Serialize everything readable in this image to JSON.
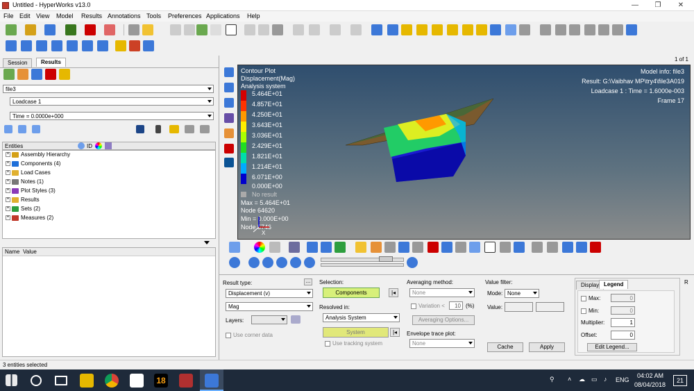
{
  "window": {
    "title": "Untitled - HyperWorks v13.0",
    "min": "—",
    "max": "❐",
    "close": "✕"
  },
  "menu": [
    "File",
    "Edit",
    "View",
    "Model",
    "Results",
    "Annotations",
    "Tools",
    "Preferences",
    "Applications",
    "Help"
  ],
  "left": {
    "tabs": [
      "Session",
      "Results"
    ],
    "file_combo": "file3",
    "loadcase_combo": "Loadcase 1",
    "time_combo": "Time = 0.0000e+000",
    "entities_header": "Entities",
    "id_header": "ID",
    "tree": [
      {
        "label": "Assembly Hierarchy",
        "color": "#d4a017"
      },
      {
        "label": "Components (4)",
        "color": "#1e6fd9"
      },
      {
        "label": "Load Cases",
        "color": "#e0b030"
      },
      {
        "label": "Notes (1)",
        "color": "#777777"
      },
      {
        "label": "Plot Styles (3)",
        "color": "#8a3ab9"
      },
      {
        "label": "Results",
        "color": "#e0b030"
      },
      {
        "label": "Sets  (2)",
        "color": "#2e9e3e"
      },
      {
        "label": "Measures (2)",
        "color": "#c0392b"
      }
    ],
    "name_header": "Name",
    "value_header": "Value"
  },
  "graphics": {
    "page": "1 of 1",
    "plot_title": "Contour Plot",
    "plot_sub": "Displacement(Mag)",
    "plot_sys": "Analysis system",
    "legend": [
      {
        "value": "5.464E+01",
        "color": "#d40000"
      },
      {
        "value": "4.857E+01",
        "color": "#ff3300"
      },
      {
        "value": "4.250E+01",
        "color": "#ff9900"
      },
      {
        "value": "3.643E+01",
        "color": "#ffee00"
      },
      {
        "value": "3.036E+01",
        "color": "#aaff00"
      },
      {
        "value": "2.429E+01",
        "color": "#22dd22"
      },
      {
        "value": "1.821E+01",
        "color": "#00ddaa"
      },
      {
        "value": "1.214E+01",
        "color": "#00aaff"
      },
      {
        "value": "6.071E+00",
        "color": "#0055ff"
      },
      {
        "value": "0.000E+00",
        "color": "#0000cc"
      }
    ],
    "no_result": "No result",
    "max_line": "Max = 5.464E+01",
    "max_node": "Node 64620",
    "min_line": "Min = 0.000E+00",
    "min_node": "Node 5746",
    "model_info": "Model info: file3",
    "result_path": "Result: G:\\Vaibhav MP\\try4\\file3A019",
    "loadcase_time": "Loadcase 1 : Time = 1.6000e-003",
    "frame": "Frame 17"
  },
  "bottom": {
    "result_type_label": "Result type:",
    "result_type": "Displacement (v)",
    "component": "Mag",
    "layers_label": "Layers:",
    "use_corner": "Use corner data",
    "selection_label": "Selection:",
    "components_btn": "Components",
    "resolved_label": "Resolved in:",
    "resolved": "Analysis System",
    "system_btn": "System",
    "use_tracking": "Use tracking system",
    "avg_label": "Averaging method:",
    "avg": "None",
    "variation": "Variation <",
    "variation_val": "10",
    "percent": "(%)",
    "avg_options": "Averaging Options...",
    "envelope_label": "Envelope trace plot:",
    "envelope": "None",
    "value_filter": "Value filter:",
    "mode_label": "Mode:",
    "mode": "None",
    "value_label": "Value:",
    "cache": "Cache",
    "apply": "Apply",
    "display_tab": "Display",
    "legend_tab": "Legend",
    "max_label": "Max:",
    "max_val": "0",
    "min_label": "Min:",
    "min_val": "0",
    "multiplier_label": "Multiplier:",
    "multiplier": "1",
    "offset_label": "Offset:",
    "offset": "0",
    "edit_legend": "Edit Legend...",
    "r_label": "R"
  },
  "status": "3 entities selected",
  "taskbar": {
    "lang": "ENG",
    "time": "04:02 AM",
    "date": "08/04/2018",
    "badge": "21",
    "num_app": "18"
  }
}
